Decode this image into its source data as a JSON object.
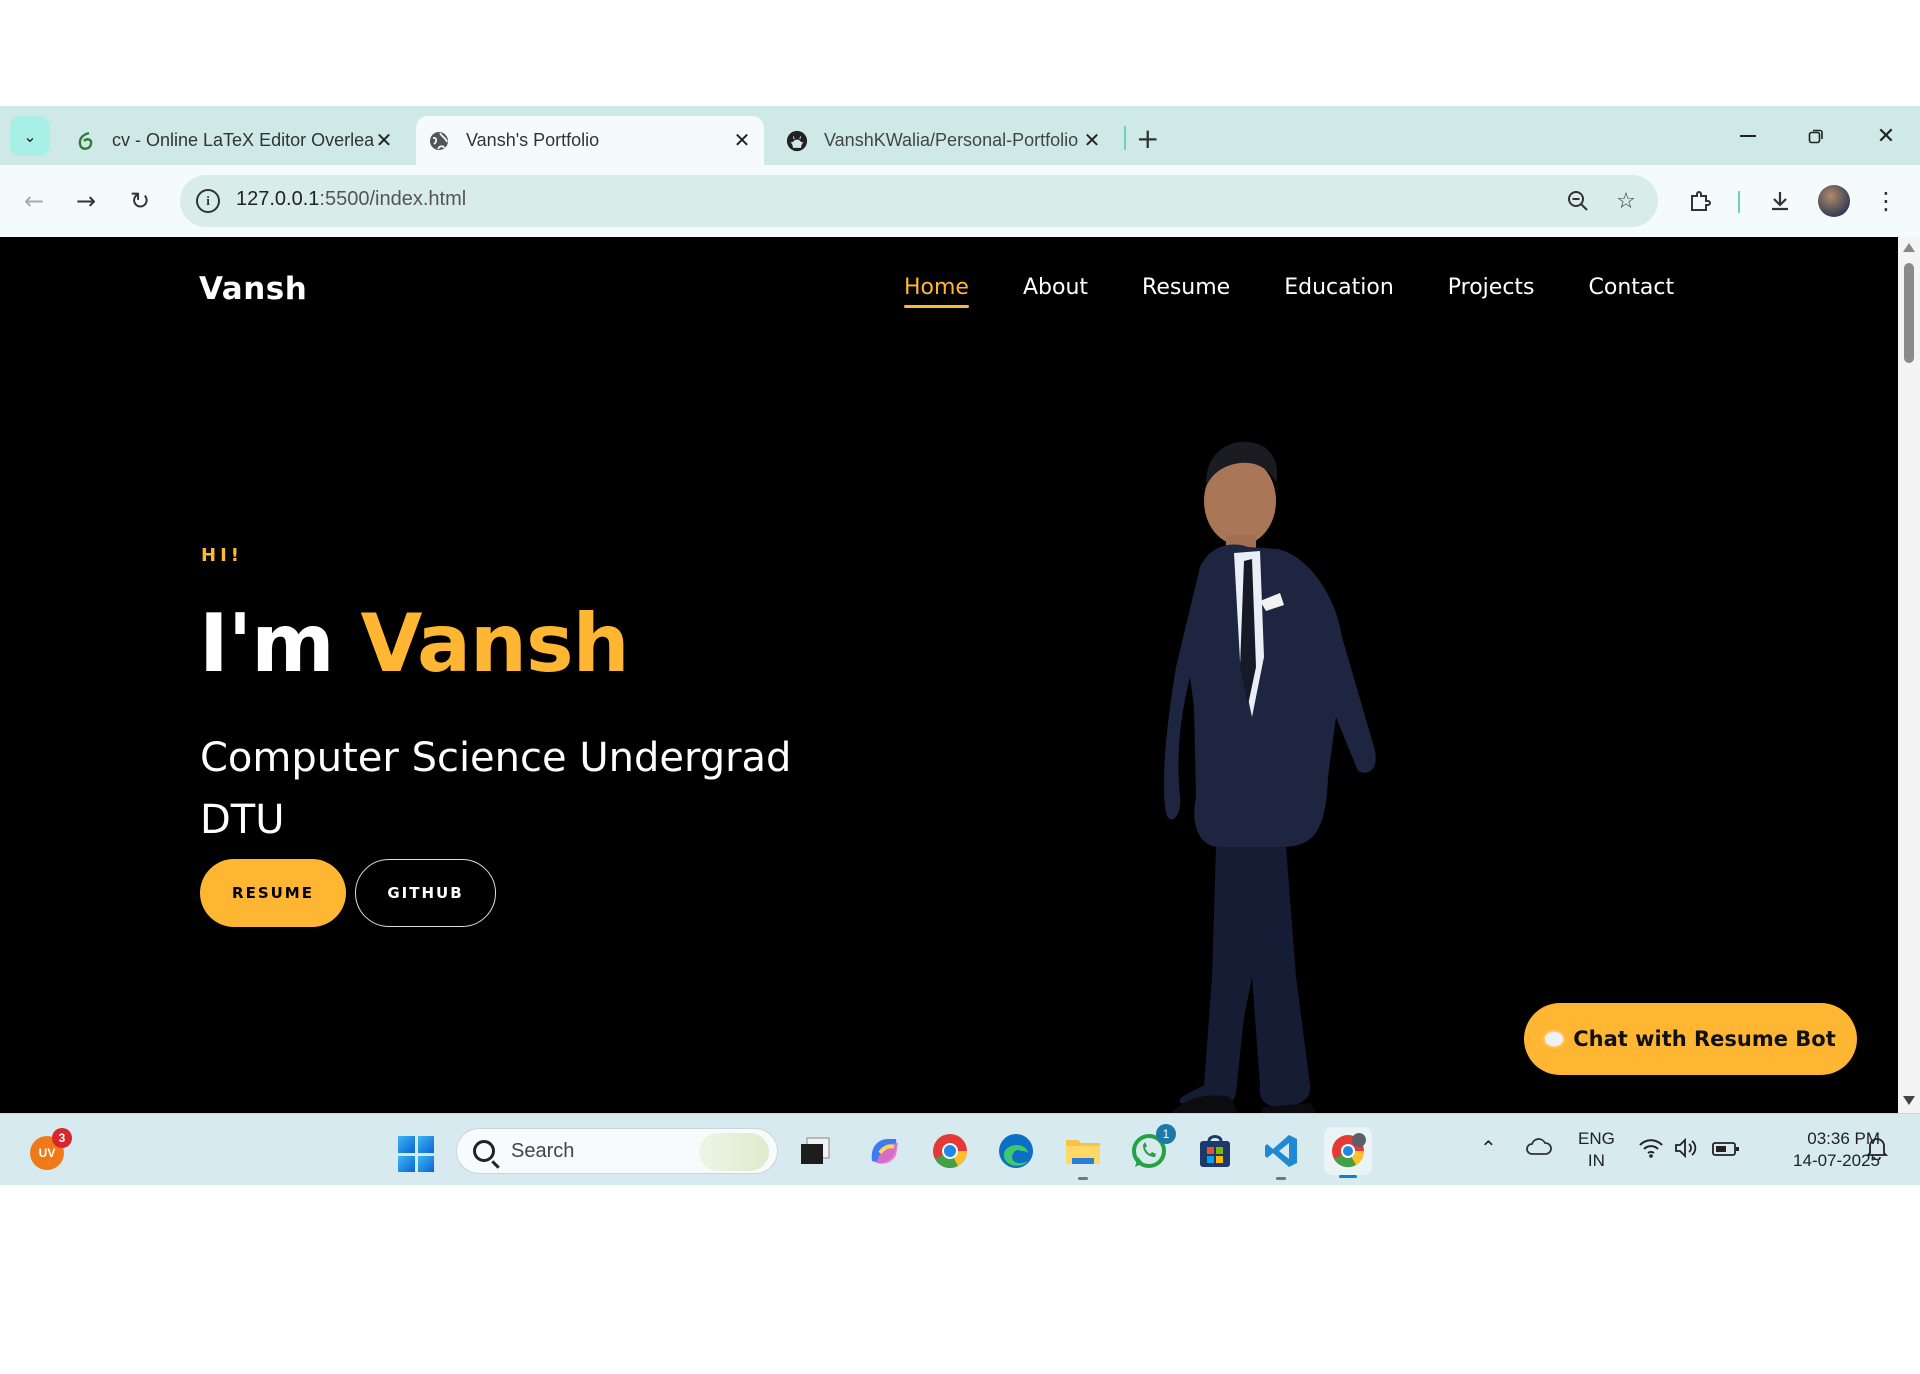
{
  "browser": {
    "tabs": [
      {
        "title": "cv - Online LaTeX Editor Overleaf",
        "icon": "overleaf-icon",
        "active": false
      },
      {
        "title": "Vansh's Portfolio",
        "icon": "globe-icon",
        "active": true
      },
      {
        "title": "VanshKWalia/Personal-Portfolio",
        "icon": "github-icon",
        "active": false
      }
    ],
    "new_tab_label": "+",
    "address": {
      "host": "127.0.0.1",
      "path": ":5500/index.html"
    }
  },
  "site": {
    "logo": "Vansh",
    "nav": [
      {
        "label": "Home",
        "active": true
      },
      {
        "label": "About",
        "active": false
      },
      {
        "label": "Resume",
        "active": false
      },
      {
        "label": "Education",
        "active": false
      },
      {
        "label": "Projects",
        "active": false
      },
      {
        "label": "Contact",
        "active": false
      }
    ],
    "hero": {
      "greeting": "HI!",
      "headline_prefix": "I'm ",
      "headline_name": "Vansh",
      "subtitle": "Computer Science Undergrad DTU",
      "buttons": {
        "resume": "RESUME",
        "github": "GITHUB"
      }
    },
    "chatbot_label": "Chat with Resume Bot",
    "accent_color": "#ffb633"
  },
  "taskbar": {
    "search_placeholder": "Search",
    "user_initials": "UV",
    "user_badge": "3",
    "whatsapp_badge": "1",
    "language": {
      "line1": "ENG",
      "line2": "IN"
    },
    "time": "03:36 PM",
    "date": "14-07-2025"
  }
}
